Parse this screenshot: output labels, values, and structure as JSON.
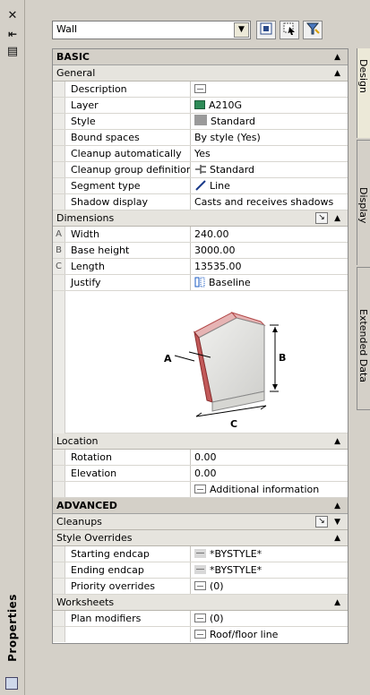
{
  "rail": {
    "close_glyph": "✕",
    "autohide_glyph": "⇤",
    "menu_glyph": "▤",
    "title": "Properties"
  },
  "toolbar": {
    "object_type": "Wall"
  },
  "basic": {
    "title": "BASIC",
    "general": {
      "title": "General",
      "rows": [
        {
          "idx": "",
          "label": "Description",
          "value": ""
        },
        {
          "idx": "",
          "label": "Layer",
          "value": "A210G"
        },
        {
          "idx": "",
          "label": "Style",
          "value": "Standard"
        },
        {
          "idx": "",
          "label": "Bound spaces",
          "value": "By style (Yes)"
        },
        {
          "idx": "",
          "label": "Cleanup automatically",
          "value": "Yes"
        },
        {
          "idx": "",
          "label": "Cleanup group definition",
          "value": "Standard"
        },
        {
          "idx": "",
          "label": "Segment type",
          "value": "Line"
        },
        {
          "idx": "",
          "label": "Shadow display",
          "value": "Casts and receives shadows"
        }
      ]
    },
    "dimensions": {
      "title": "Dimensions",
      "rows": [
        {
          "idx": "A",
          "label": "Width",
          "value": "240.00"
        },
        {
          "idx": "B",
          "label": "Base height",
          "value": "3000.00"
        },
        {
          "idx": "C",
          "label": "Length",
          "value": "13535.00"
        },
        {
          "idx": "",
          "label": "Justify",
          "value": "Baseline"
        }
      ],
      "diagram_labels": {
        "a": "A",
        "b": "B",
        "c": "C"
      }
    },
    "location": {
      "title": "Location",
      "rows": [
        {
          "idx": "",
          "label": "Rotation",
          "value": "0.00"
        },
        {
          "idx": "",
          "label": "Elevation",
          "value": "0.00"
        },
        {
          "idx": "",
          "label": "",
          "value": "Additional information"
        }
      ]
    }
  },
  "advanced": {
    "title": "ADVANCED",
    "cleanups": {
      "title": "Cleanups"
    },
    "style_overrides": {
      "title": "Style Overrides",
      "rows": [
        {
          "idx": "",
          "label": "Starting endcap",
          "value": "*BYSTYLE*"
        },
        {
          "idx": "",
          "label": "Ending endcap",
          "value": "*BYSTYLE*"
        },
        {
          "idx": "",
          "label": "Priority overrides",
          "value": "(0)"
        }
      ]
    },
    "worksheets": {
      "title": "Worksheets",
      "rows": [
        {
          "idx": "",
          "label": "Plan modifiers",
          "value": "(0)"
        },
        {
          "idx": "",
          "label": "",
          "value": "Roof/floor line"
        }
      ]
    }
  },
  "tabs": {
    "design": "Design",
    "display": "Display",
    "extended": "Extended Data"
  },
  "colors": {
    "layer_swatch": "#2e8b57",
    "style_swatch": "#9a9a9a",
    "wall_face": "#e8e8e4",
    "wall_edge": "#b34a4a"
  }
}
